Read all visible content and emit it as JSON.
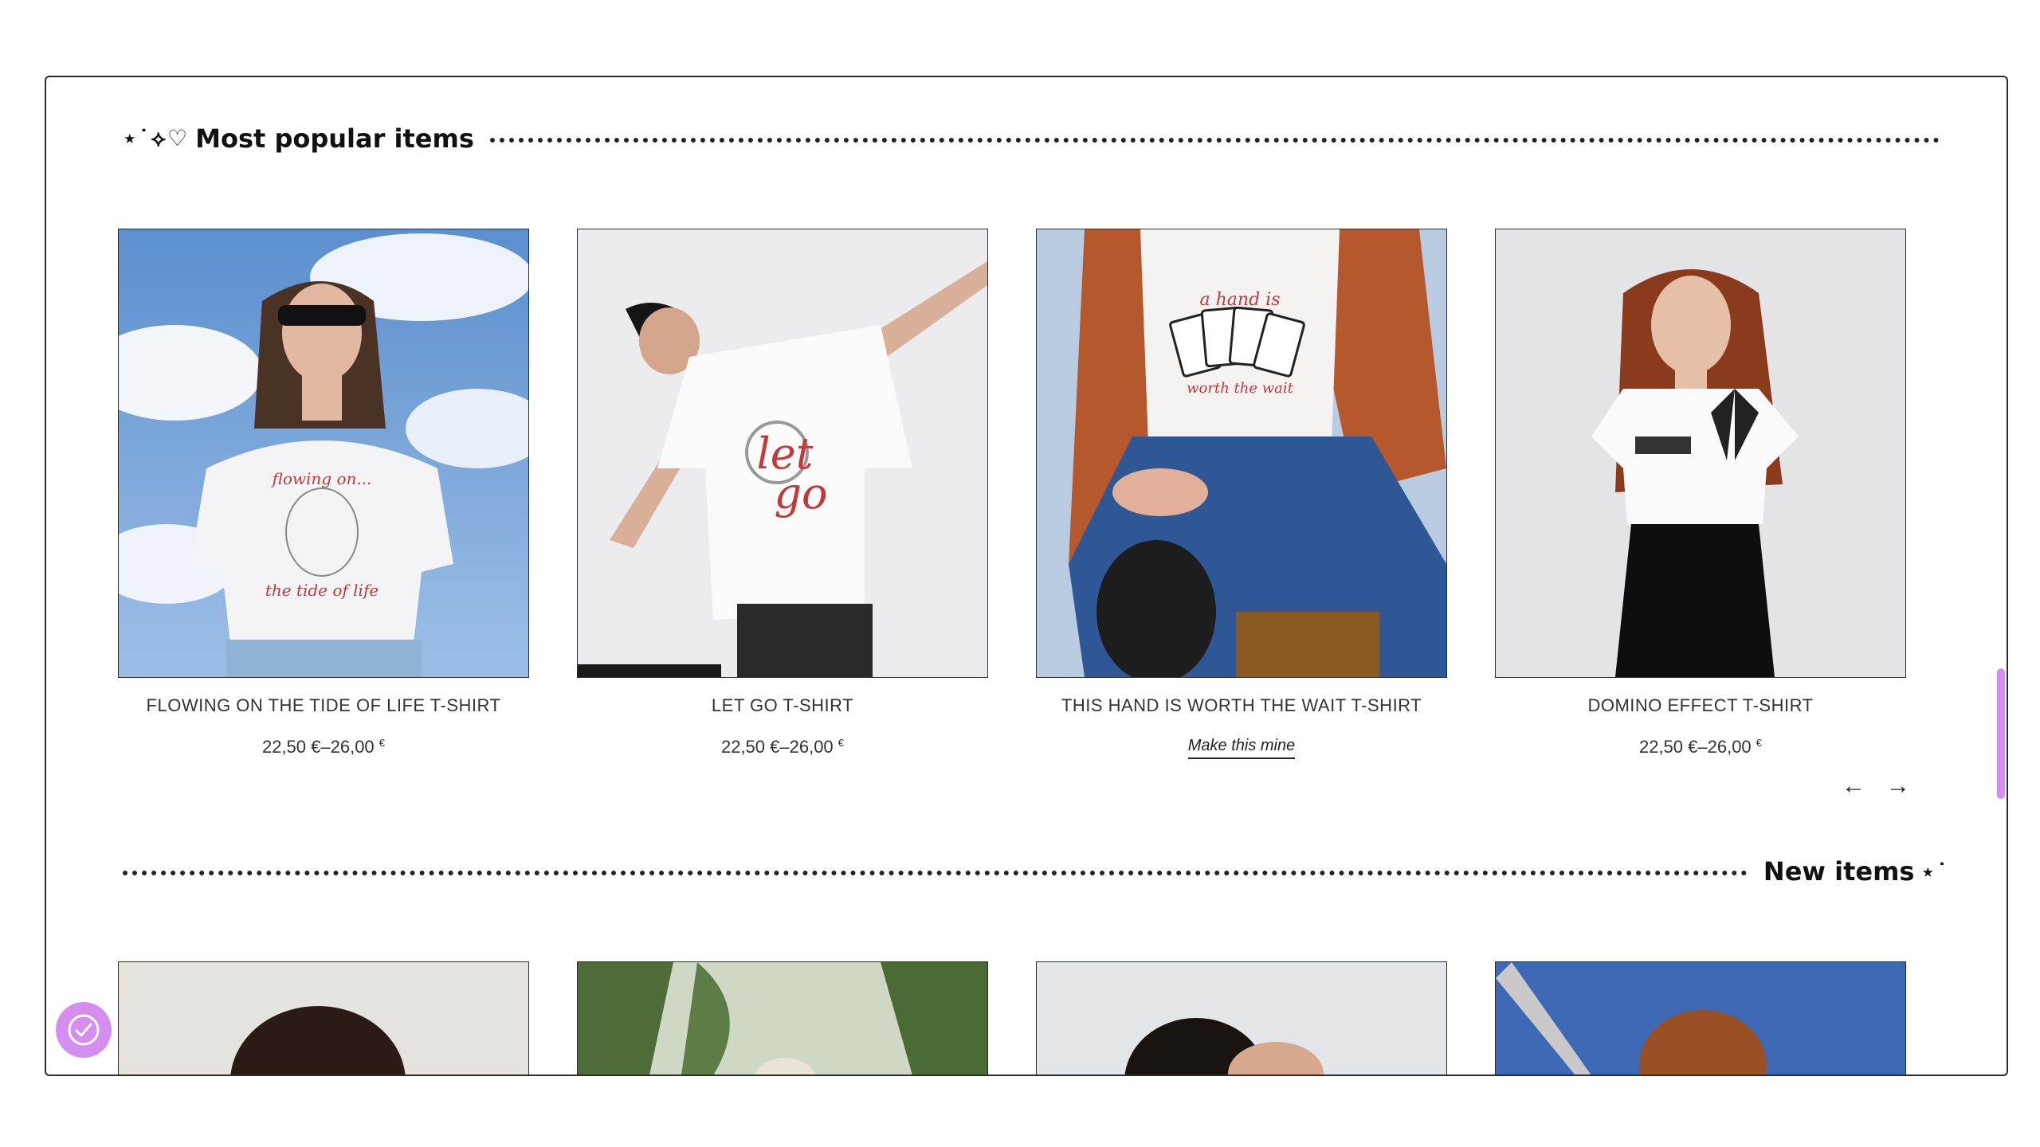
{
  "popular": {
    "title": "Most popular items",
    "title_deco": "⋆˙⟡♡",
    "items": [
      {
        "name": "FLOWING ON THE TIDE OF LIFE T-SHIRT",
        "price": "22,50 €–26,00",
        "currency": "€"
      },
      {
        "name": "LET GO T-SHIRT",
        "price": "22,50 €–26,00",
        "currency": "€"
      },
      {
        "name": "THIS HAND IS WORTH THE WAIT T-SHIRT",
        "link": "Make this mine"
      },
      {
        "name": "DOMINO EFFECT T-SHIRT",
        "price": "22,50 €–26,00",
        "currency": "€"
      }
    ],
    "prev_arrow": "←",
    "next_arrow": "→"
  },
  "new_items": {
    "title": "New items",
    "title_deco": "⋆˙"
  },
  "colors": {
    "accent": "#d58ef0",
    "border": "#2b2b2b"
  },
  "icons": {
    "fab": "accessibility-badge-icon"
  }
}
